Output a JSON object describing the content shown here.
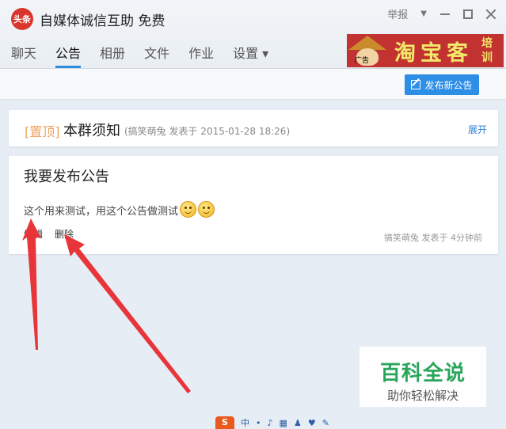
{
  "window": {
    "title": "自媒体诚信互助 免费",
    "logo_text": "头条",
    "report_label": "举报",
    "dropdown_glyph": "▼"
  },
  "tabs": [
    {
      "label": "聊天"
    },
    {
      "label": "公告"
    },
    {
      "label": "相册"
    },
    {
      "label": "文件"
    },
    {
      "label": "作业"
    },
    {
      "label": "设置 ▾"
    }
  ],
  "ad": {
    "tag": "广告",
    "text": "淘宝客",
    "side": "培训"
  },
  "toolbar": {
    "publish_label": "发布新公告"
  },
  "pinned_notice": {
    "tag": "[置顶]",
    "title": "本群须知",
    "meta": "(搞笑萌兔 发表于 2015-01-28 18:26)",
    "expand_label": "展开"
  },
  "notice": {
    "title": "我要发布公告",
    "body": "这个用来测试，用这个公告做测试",
    "edit_label": "编辑",
    "delete_label": "删除",
    "meta": "搞笑萌兔 发表于 4分钟前"
  },
  "watermark": {
    "main": "百科全说",
    "sub": "助你轻松解决"
  },
  "ime": {
    "logo": "S",
    "mode": "中"
  },
  "colors": {
    "accent": "#2d8ee6",
    "pin_tag": "#f0a35e",
    "arrow": "#e8353a",
    "watermark_green": "#2aa65a"
  }
}
